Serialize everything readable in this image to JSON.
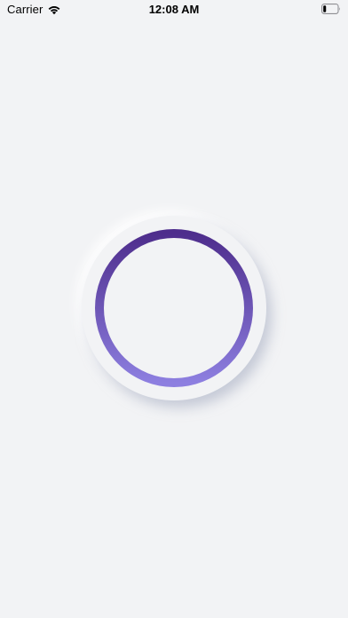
{
  "status_bar": {
    "carrier": "Carrier",
    "time": "12:08 AM",
    "icons": {
      "wifi": "wifi-icon",
      "battery": "battery-icon"
    },
    "battery_level": 0.2
  },
  "knob": {
    "icon": "progress-ring",
    "colors": {
      "background": "#f2f3f5",
      "ring_top": "#4e2d8c",
      "ring_bottom": "#8d7fe0"
    }
  }
}
